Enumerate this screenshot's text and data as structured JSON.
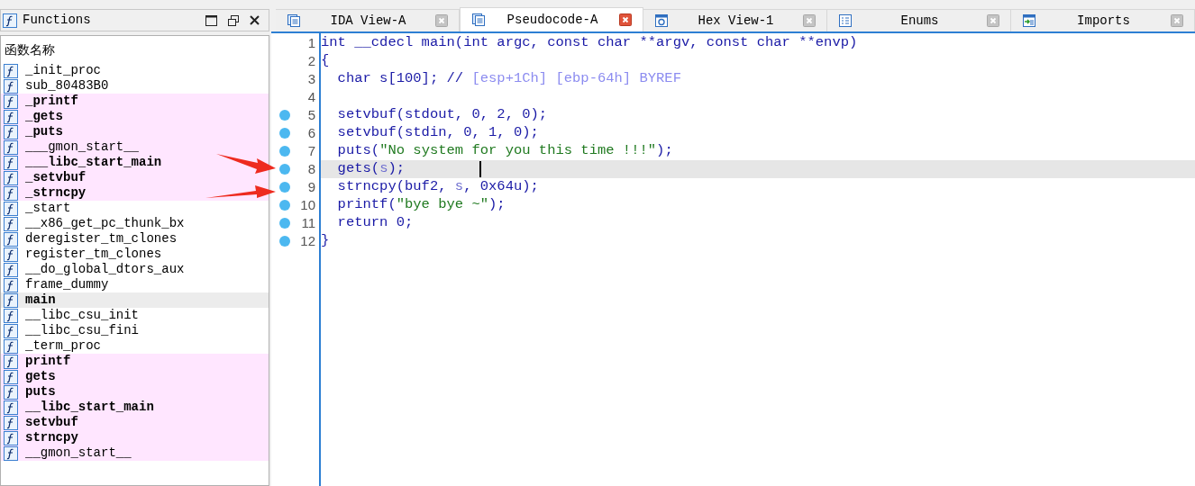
{
  "functions_panel": {
    "title": "Functions",
    "column_header": "函数名称",
    "items": [
      {
        "name": "_init_proc",
        "bold": false,
        "highlighted": false,
        "selected": false
      },
      {
        "name": "sub_80483B0",
        "bold": false,
        "highlighted": false,
        "selected": false
      },
      {
        "name": "_printf",
        "bold": true,
        "highlighted": true,
        "selected": false
      },
      {
        "name": "_gets",
        "bold": true,
        "highlighted": true,
        "selected": false
      },
      {
        "name": "_puts",
        "bold": true,
        "highlighted": true,
        "selected": false
      },
      {
        "name": "___gmon_start__",
        "bold": false,
        "highlighted": true,
        "selected": false
      },
      {
        "name": "___libc_start_main",
        "bold": true,
        "highlighted": true,
        "selected": false
      },
      {
        "name": "_setvbuf",
        "bold": true,
        "highlighted": true,
        "selected": false
      },
      {
        "name": "_strncpy",
        "bold": true,
        "highlighted": true,
        "selected": false
      },
      {
        "name": "_start",
        "bold": false,
        "highlighted": false,
        "selected": false
      },
      {
        "name": "__x86_get_pc_thunk_bx",
        "bold": false,
        "highlighted": false,
        "selected": false
      },
      {
        "name": "deregister_tm_clones",
        "bold": false,
        "highlighted": false,
        "selected": false
      },
      {
        "name": "register_tm_clones",
        "bold": false,
        "highlighted": false,
        "selected": false
      },
      {
        "name": "__do_global_dtors_aux",
        "bold": false,
        "highlighted": false,
        "selected": false
      },
      {
        "name": "frame_dummy",
        "bold": false,
        "highlighted": false,
        "selected": false
      },
      {
        "name": "main",
        "bold": true,
        "highlighted": false,
        "selected": true
      },
      {
        "name": "__libc_csu_init",
        "bold": false,
        "highlighted": false,
        "selected": false
      },
      {
        "name": "__libc_csu_fini",
        "bold": false,
        "highlighted": false,
        "selected": false
      },
      {
        "name": "_term_proc",
        "bold": false,
        "highlighted": false,
        "selected": false
      },
      {
        "name": "printf",
        "bold": true,
        "highlighted": true,
        "selected": false
      },
      {
        "name": "gets",
        "bold": true,
        "highlighted": true,
        "selected": false
      },
      {
        "name": "puts",
        "bold": true,
        "highlighted": true,
        "selected": false
      },
      {
        "name": "__libc_start_main",
        "bold": true,
        "highlighted": true,
        "selected": false
      },
      {
        "name": "setvbuf",
        "bold": true,
        "highlighted": true,
        "selected": false
      },
      {
        "name": "strncpy",
        "bold": true,
        "highlighted": true,
        "selected": false
      },
      {
        "name": "__gmon_start__",
        "bold": false,
        "highlighted": true,
        "selected": false
      }
    ]
  },
  "tabs": [
    {
      "label": "IDA View-A",
      "kind": "listing",
      "selected": false
    },
    {
      "label": "Pseudocode-A",
      "kind": "listing",
      "selected": true
    },
    {
      "label": "Hex View-1",
      "kind": "hex",
      "selected": false
    },
    {
      "label": "Enums",
      "kind": "enums",
      "selected": false
    },
    {
      "label": "Imports",
      "kind": "imports",
      "selected": false
    }
  ],
  "code": {
    "lines": [
      {
        "number": "1",
        "breakpoint": false,
        "current": false,
        "segments": [
          {
            "kind": "code",
            "text": "int __cdecl main(int argc, const char **argv, const char **envp)"
          }
        ]
      },
      {
        "number": "2",
        "breakpoint": false,
        "current": false,
        "segments": [
          {
            "kind": "code",
            "text": "{"
          }
        ]
      },
      {
        "number": "3",
        "breakpoint": false,
        "current": false,
        "segments": [
          {
            "kind": "code",
            "text": "  char s[100]; // "
          },
          {
            "kind": "comment",
            "text": "[esp+1Ch] [ebp-64h] BYREF"
          }
        ]
      },
      {
        "number": "4",
        "breakpoint": false,
        "current": false
      },
      {
        "number": "5",
        "breakpoint": true,
        "current": false,
        "segments": [
          {
            "kind": "code",
            "text": "  setvbuf(stdout, 0, 2, 0);"
          }
        ]
      },
      {
        "number": "6",
        "breakpoint": true,
        "current": false,
        "segments": [
          {
            "kind": "code",
            "text": "  setvbuf(stdin, 0, 1, 0);"
          }
        ]
      },
      {
        "number": "7",
        "breakpoint": true,
        "current": false,
        "segments": [
          {
            "kind": "code",
            "text": "  puts("
          },
          {
            "kind": "string",
            "text": "\"No system for you this time !!!\""
          },
          {
            "kind": "code",
            "text": ");"
          }
        ]
      },
      {
        "number": "8",
        "breakpoint": true,
        "current": true,
        "segments": [
          {
            "kind": "code",
            "text": "  gets("
          },
          {
            "kind": "var",
            "text": "s"
          },
          {
            "kind": "code",
            "text": ");"
          }
        ]
      },
      {
        "number": "9",
        "breakpoint": true,
        "current": false,
        "segments": [
          {
            "kind": "code",
            "text": "  strncpy(buf2, "
          },
          {
            "kind": "var",
            "text": "s"
          },
          {
            "kind": "code",
            "text": ", 0x64u);"
          }
        ]
      },
      {
        "number": "10",
        "breakpoint": true,
        "current": false,
        "segments": [
          {
            "kind": "code",
            "text": "  printf("
          },
          {
            "kind": "string",
            "text": "\"bye bye ~\""
          },
          {
            "kind": "code",
            "text": ");"
          }
        ]
      },
      {
        "number": "11",
        "breakpoint": true,
        "current": false,
        "segments": [
          {
            "kind": "code",
            "text": "  return 0;"
          }
        ]
      },
      {
        "number": "12",
        "breakpoint": true,
        "current": false,
        "segments": [
          {
            "kind": "code",
            "text": "}"
          }
        ]
      }
    ]
  }
}
